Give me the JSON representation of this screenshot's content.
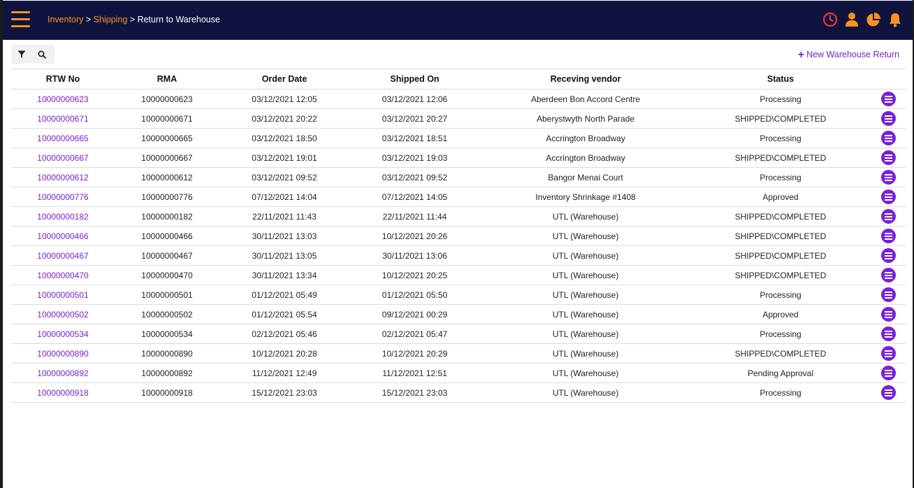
{
  "header": {
    "breadcrumb": [
      {
        "label": "Inventory",
        "link": true
      },
      {
        "label": "Shipping",
        "link": true
      },
      {
        "label": "Return to Warehouse",
        "link": false
      }
    ],
    "separator": " > ",
    "icons": [
      "clock-icon",
      "user-icon",
      "pie-chart-icon",
      "bell-icon"
    ],
    "accent_color": "#f7941d",
    "alert_color": "#e83a3a",
    "bar_color": "#11133f"
  },
  "toolbar": {
    "filter_icon": "filter-icon",
    "search_icon": "search-icon",
    "new_button_label": "New Warehouse Return",
    "new_button_color": "#7a1fe0"
  },
  "table": {
    "columns": [
      "RTW No",
      "RMA",
      "Order Date",
      "Shipped On",
      "Receving vendor",
      "Status",
      ""
    ],
    "rows": [
      {
        "rtw": "10000000623",
        "rma": "10000000623",
        "order_date": "03/12/2021 12:05",
        "shipped_on": "03/12/2021 12:06",
        "vendor": "Aberdeen Bon Accord Centre",
        "status": "Processing"
      },
      {
        "rtw": "10000000671",
        "rma": "10000000671",
        "order_date": "03/12/2021 20:22",
        "shipped_on": "03/12/2021 20:27",
        "vendor": "Aberystwyth North Parade",
        "status": "SHIPPED\\COMPLETED"
      },
      {
        "rtw": "10000000665",
        "rma": "10000000665",
        "order_date": "03/12/2021 18:50",
        "shipped_on": "03/12/2021 18:51",
        "vendor": "Accrington Broadway",
        "status": "Processing"
      },
      {
        "rtw": "10000000667",
        "rma": "10000000667",
        "order_date": "03/12/2021 19:01",
        "shipped_on": "03/12/2021 19:03",
        "vendor": "Accrington Broadway",
        "status": "SHIPPED\\COMPLETED"
      },
      {
        "rtw": "10000000612",
        "rma": "10000000612",
        "order_date": "03/12/2021 09:52",
        "shipped_on": "03/12/2021 09:52",
        "vendor": "Bangor Menai Court",
        "status": "Processing"
      },
      {
        "rtw": "10000000776",
        "rma": "10000000776",
        "order_date": "07/12/2021 14:04",
        "shipped_on": "07/12/2021 14:05",
        "vendor": "Inventory Shrinkage #1408",
        "status": "Approved"
      },
      {
        "rtw": "10000000182",
        "rma": "10000000182",
        "order_date": "22/11/2021 11:43",
        "shipped_on": "22/11/2021 11:44",
        "vendor": "UTL (Warehouse)",
        "status": "SHIPPED\\COMPLETED"
      },
      {
        "rtw": "10000000466",
        "rma": "10000000466",
        "order_date": "30/11/2021 13:03",
        "shipped_on": "10/12/2021 20:26",
        "vendor": "UTL (Warehouse)",
        "status": "SHIPPED\\COMPLETED"
      },
      {
        "rtw": "10000000467",
        "rma": "10000000467",
        "order_date": "30/11/2021 13:05",
        "shipped_on": "30/11/2021 13:06",
        "vendor": "UTL (Warehouse)",
        "status": "SHIPPED\\COMPLETED"
      },
      {
        "rtw": "10000000470",
        "rma": "10000000470",
        "order_date": "30/11/2021 13:34",
        "shipped_on": "10/12/2021 20:25",
        "vendor": "UTL (Warehouse)",
        "status": "SHIPPED\\COMPLETED"
      },
      {
        "rtw": "10000000501",
        "rma": "10000000501",
        "order_date": "01/12/2021 05:49",
        "shipped_on": "01/12/2021 05:50",
        "vendor": "UTL (Warehouse)",
        "status": "Processing"
      },
      {
        "rtw": "10000000502",
        "rma": "10000000502",
        "order_date": "01/12/2021 05:54",
        "shipped_on": "09/12/2021 00:29",
        "vendor": "UTL (Warehouse)",
        "status": "Approved"
      },
      {
        "rtw": "10000000534",
        "rma": "10000000534",
        "order_date": "02/12/2021 05:46",
        "shipped_on": "02/12/2021 05:47",
        "vendor": "UTL (Warehouse)",
        "status": "Processing"
      },
      {
        "rtw": "10000000890",
        "rma": "10000000890",
        "order_date": "10/12/2021 20:28",
        "shipped_on": "10/12/2021 20:29",
        "vendor": "UTL (Warehouse)",
        "status": "SHIPPED\\COMPLETED"
      },
      {
        "rtw": "10000000892",
        "rma": "10000000892",
        "order_date": "11/12/2021 12:49",
        "shipped_on": "11/12/2021 12:51",
        "vendor": "UTL (Warehouse)",
        "status": "Pending Approval"
      },
      {
        "rtw": "10000000918",
        "rma": "10000000918",
        "order_date": "15/12/2021 23:03",
        "shipped_on": "15/12/2021 23:03",
        "vendor": "UTL (Warehouse)",
        "status": "Processing"
      }
    ],
    "row_action_icon": "menu-lines-icon"
  }
}
